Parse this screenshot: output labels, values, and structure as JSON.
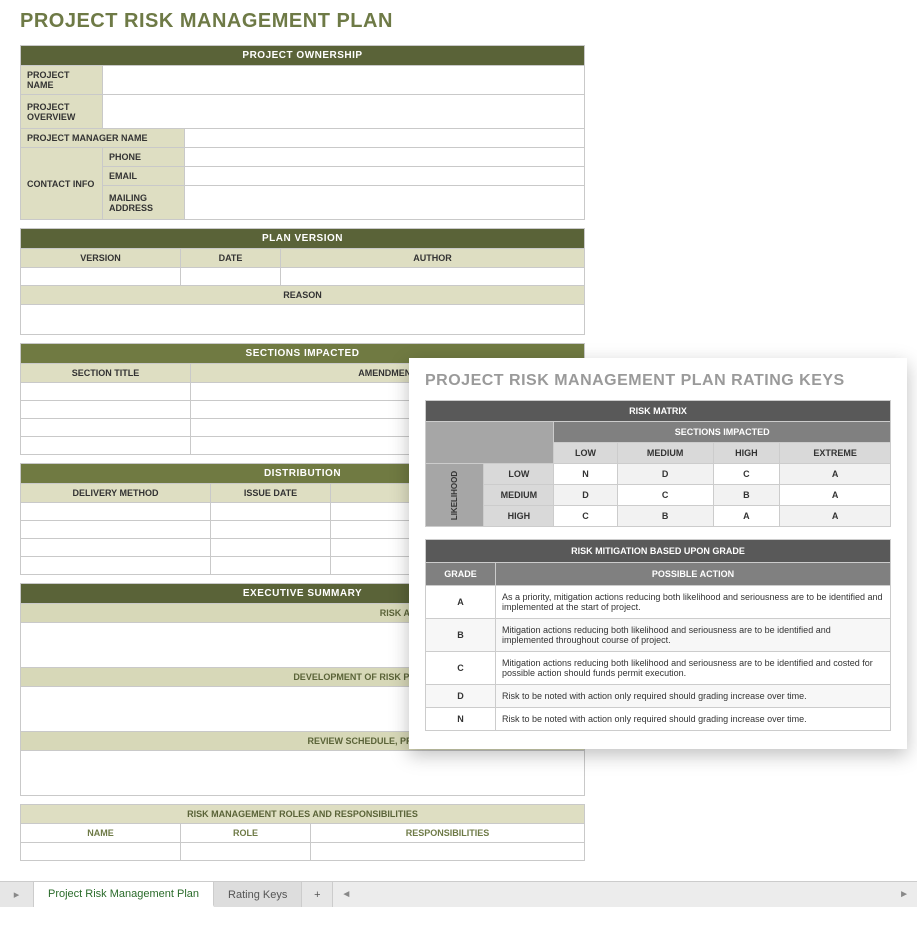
{
  "title": "PROJECT RISK MANAGEMENT PLAN",
  "ownership": {
    "header": "PROJECT OWNERSHIP",
    "labels": {
      "projectName": "PROJECT NAME",
      "projectOverview": "PROJECT OVERVIEW",
      "projectManagerName": "PROJECT MANAGER NAME",
      "contactInfo": "CONTACT INFO",
      "phone": "PHONE",
      "email": "EMAIL",
      "mailing": "MAILING ADDRESS"
    }
  },
  "planVersion": {
    "header": "PLAN VERSION",
    "cols": {
      "version": "VERSION",
      "date": "DATE",
      "author": "AUTHOR"
    },
    "reason": "REASON"
  },
  "sectionsImpacted": {
    "header": "SECTIONS IMPACTED",
    "cols": {
      "title": "SECTION TITLE",
      "amend": "AMENDMENT"
    }
  },
  "distribution": {
    "header": "DISTRIBUTION",
    "cols": {
      "method": "DELIVERY METHOD",
      "issue": "ISSUE DATE"
    }
  },
  "execSummary": {
    "header": "EXECUTIVE SUMMARY",
    "rows": [
      "RISK ANALYSIS AND EVALUATION PROCESS",
      "DEVELOPMENT OF RISK PREVENTION MITIGATION STRATEGIES",
      "REVIEW SCHEDULE, PROCESS, AND PARTIES RESPONSIBLE"
    ]
  },
  "roles": {
    "header": "RISK MANAGEMENT ROLES AND RESPONSIBILITIES",
    "cols": {
      "name": "NAME",
      "role": "ROLE",
      "resp": "RESPONSIBILITIES"
    }
  },
  "overlay": {
    "title": "PROJECT RISK MANAGEMENT PLAN RATING KEYS",
    "matrix": {
      "header": "RISK MATRIX",
      "sub": "SECTIONS IMPACTED",
      "side": "LIKELIHOOD",
      "cols": [
        "LOW",
        "MEDIUM",
        "HIGH",
        "EXTREME"
      ],
      "rows": [
        "LOW",
        "MEDIUM",
        "HIGH"
      ],
      "data": [
        [
          "N",
          "D",
          "C",
          "A"
        ],
        [
          "D",
          "C",
          "B",
          "A"
        ],
        [
          "C",
          "B",
          "A",
          "A"
        ]
      ]
    },
    "mitigation": {
      "header": "RISK MITIGATION BASED UPON GRADE",
      "cols": {
        "grade": "GRADE",
        "action": "POSSIBLE ACTION"
      },
      "rows": [
        {
          "g": "A",
          "t": "As a priority, mitigation actions reducing both likelihood and seriousness are to be identified and implemented at the start of project."
        },
        {
          "g": "B",
          "t": "Mitigation actions reducing both likelihood and seriousness are to be identified and implemented throughout course of project."
        },
        {
          "g": "C",
          "t": "Mitigation actions reducing both likelihood and seriousness are to be identified and costed for possible action should funds permit execution."
        },
        {
          "g": "D",
          "t": "Risk to be noted with action only required should grading increase over time."
        },
        {
          "g": "N",
          "t": "Risk to be noted with action only required should grading increase over time."
        }
      ]
    }
  },
  "tabs": {
    "t1": "Project Risk Management Plan",
    "t2": "Rating Keys",
    "add": "+"
  }
}
